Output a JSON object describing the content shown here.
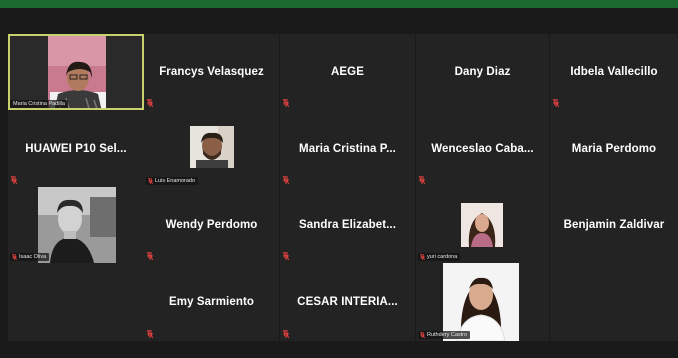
{
  "colors": {
    "topbar": "#1b6b2f",
    "tile": "#232323",
    "active_border": "#c8d26a",
    "muted_mic": "#e0413f"
  },
  "tiles": [
    {
      "name": "Maria Cristina Padilla",
      "label": "Maria Cristina Padilla",
      "video": true,
      "active": true
    },
    {
      "name": "Francys Velasquez",
      "video": false
    },
    {
      "name": "AEGE",
      "video": false
    },
    {
      "name": "Dany Diaz",
      "video": false
    },
    {
      "name": "Idbela Vallecillo",
      "video": false
    },
    {
      "name": "HUAWEI P10 Sel...",
      "video": false
    },
    {
      "name": "Luis Enamorado",
      "label": "Luis Enamorado",
      "video": true
    },
    {
      "name": "Maria Cristina P...",
      "video": false
    },
    {
      "name": "Wenceslao Caba...",
      "video": false
    },
    {
      "name": "Maria Perdomo",
      "video": false
    },
    {
      "name": "Isaac Oliva",
      "label": "Isaac Oliva",
      "video": true
    },
    {
      "name": "Wendy Perdomo",
      "video": false
    },
    {
      "name": "Sandra Elizabet...",
      "video": false
    },
    {
      "name": "yuri cardona",
      "label": "yuri cardona",
      "video": true
    },
    {
      "name": "Benjamin Zaldivar",
      "video": false
    },
    {
      "name": "Emy Sarmiento",
      "video": false
    },
    {
      "name": "CESAR INTERIA...",
      "video": false
    },
    {
      "name": "Ruthdery Castro",
      "label": "Ruthdery Castro",
      "video": true
    }
  ]
}
